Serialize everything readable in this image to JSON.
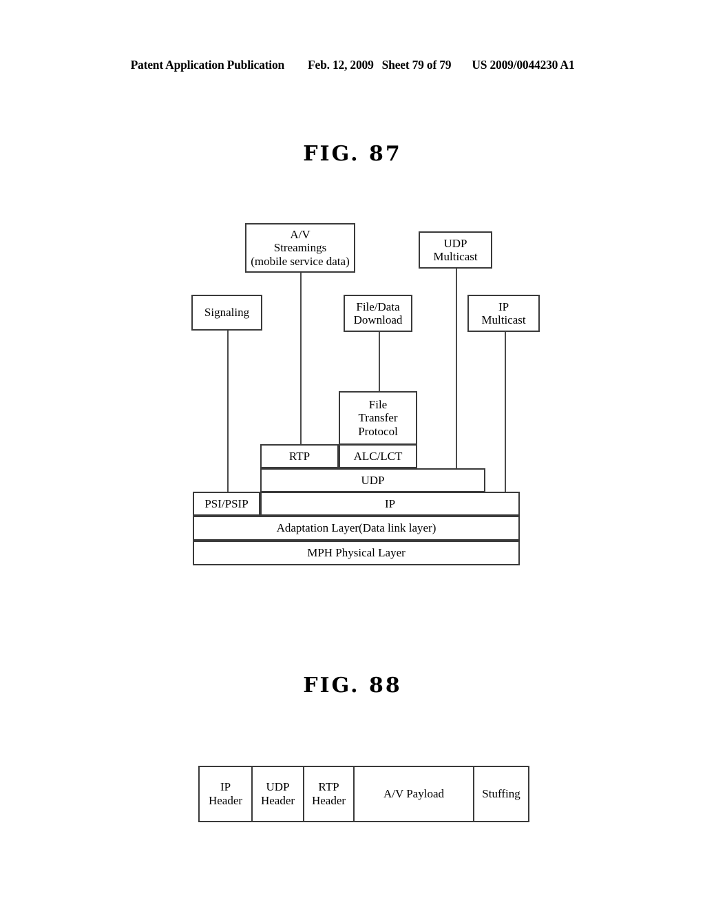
{
  "header": {
    "publication": "Patent Application Publication",
    "date": "Feb. 12, 2009",
    "sheet": "Sheet 79 of 79",
    "patent_number": "US 2009/0044230 A1"
  },
  "figures": {
    "fig87": {
      "title": "FIG. 87",
      "type": "protocol-stack-diagram",
      "boxes": {
        "av_streamings": {
          "line1": "A/V",
          "line2": "Streamings",
          "line3": "(mobile service data)"
        },
        "udp_multicast": {
          "line1": "UDP",
          "line2": "Multicast"
        },
        "signaling": {
          "line1": "Signaling"
        },
        "file_data_download": {
          "line1": "File/Data",
          "line2": "Download"
        },
        "ip_multicast": {
          "line1": "IP",
          "line2": "Multicast"
        },
        "file_transfer_protocol": {
          "line1": "File",
          "line2": "Transfer",
          "line3": "Protocol"
        },
        "rtp": {
          "line1": "RTP"
        },
        "alc_lct": {
          "line1": "ALC/LCT"
        },
        "udp": {
          "line1": "UDP"
        },
        "psi_psip": {
          "line1": "PSI/PSIP"
        },
        "ip": {
          "line1": "IP"
        },
        "adaptation_layer": {
          "line1": "Adaptation Layer(Data link layer)"
        },
        "mph_physical_layer": {
          "line1": "MPH Physical Layer"
        }
      },
      "connections": [
        {
          "from": "signaling",
          "to": "psi_psip"
        },
        {
          "from": "av_streamings",
          "to": "rtp"
        },
        {
          "from": "file_data_download",
          "to": "file_transfer_protocol"
        },
        {
          "from": "udp_multicast",
          "to": "udp"
        },
        {
          "from": "ip_multicast",
          "to": "ip"
        }
      ]
    },
    "fig88": {
      "title": "FIG. 88",
      "type": "packet-structure-table",
      "cells": [
        {
          "line1": "IP",
          "line2": "Header"
        },
        {
          "line1": "UDP",
          "line2": "Header"
        },
        {
          "line1": "RTP",
          "line2": "Header"
        },
        {
          "line1": "A/V Payload",
          "line2": ""
        },
        {
          "line1": "Stuffing",
          "line2": ""
        }
      ]
    }
  },
  "colors": {
    "page_background": "#ffffff",
    "ink": "#000000",
    "box_stroke": "#3a3a3a",
    "line_stroke": "#4a4a4a"
  }
}
